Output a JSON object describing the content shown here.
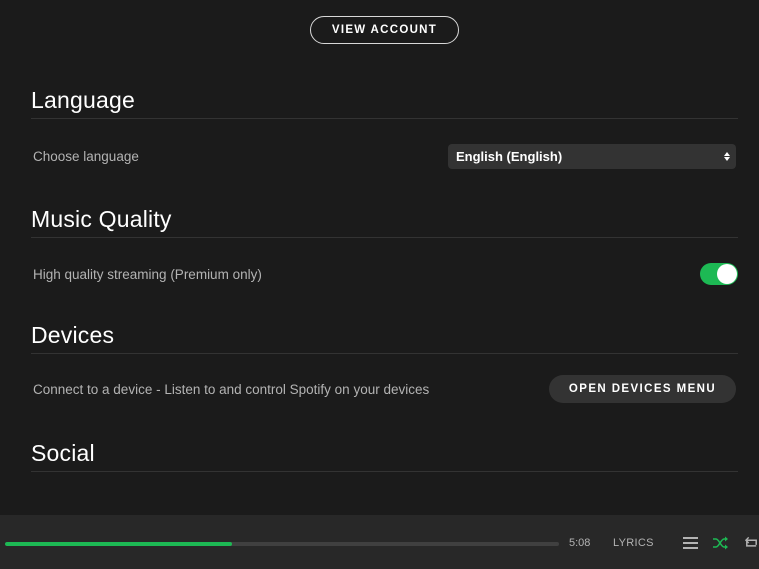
{
  "account": {
    "view_account_label": "VIEW ACCOUNT"
  },
  "sections": {
    "language": {
      "title": "Language",
      "row_label": "Choose language",
      "selected_value": "English (English)"
    },
    "music_quality": {
      "title": "Music Quality",
      "row_label": "High quality streaming (Premium only)",
      "toggle_on": true
    },
    "devices": {
      "title": "Devices",
      "row_label": "Connect to a device - Listen to and control Spotify on your devices",
      "button_label": "OPEN DEVICES MENU"
    },
    "social": {
      "title": "Social"
    }
  },
  "player": {
    "total_time": "5:08",
    "progress_fraction": 0.41,
    "lyrics_label": "LYRICS",
    "icons": [
      "queue-icon",
      "shuffle-icon",
      "repeat-icon"
    ],
    "shuffle_active": true
  },
  "colors": {
    "accent": "#1db954",
    "background": "#1b1b1b",
    "player_background": "#282828",
    "muted_text": "#b3b3b3"
  }
}
